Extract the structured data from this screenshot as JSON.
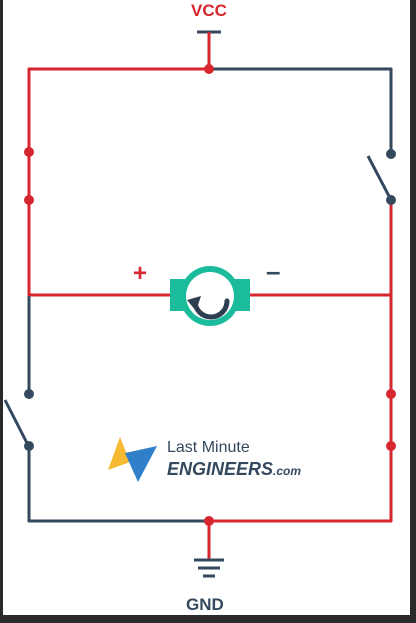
{
  "labels": {
    "vcc": "VCC",
    "gnd": "GND",
    "motor_positive": "+",
    "motor_negative": "–"
  },
  "logo": {
    "line1": "Last Minute",
    "brand": "ENGINEERS",
    "tld": ".com"
  },
  "colors": {
    "active_wire": "#d7262f",
    "inactive_wire": "#34495e",
    "motor_body": "#1abc9c",
    "motor_arrow": "#2c3e50",
    "logo_text": "#34495e",
    "logo_bolt_yellow": "#f7b930",
    "logo_bolt_blue": "#2f80c8",
    "background": "#ffffff",
    "frame_border": "#2a2a2a"
  },
  "switches": [
    {
      "name": "top-left-switch",
      "state": "closed"
    },
    {
      "name": "top-right-switch",
      "state": "open"
    },
    {
      "name": "bottom-left-switch",
      "state": "open"
    },
    {
      "name": "bottom-right-switch",
      "state": "closed"
    }
  ],
  "motor": {
    "rotation": "counter-clockwise"
  }
}
